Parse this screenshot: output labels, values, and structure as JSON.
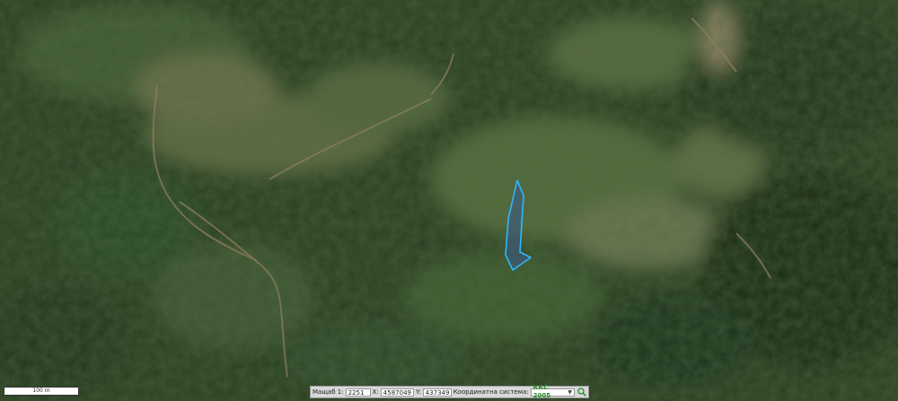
{
  "map": {
    "colors": {
      "forest_dark": "#1f3319",
      "forest": "#2c4524",
      "meadow": "#5a6a3e",
      "meadow_light": "#7b7a55",
      "track": "#8a7c5c",
      "parcel_stroke": "#2fb7ff",
      "parcel_fill": "#3b5a8a"
    }
  },
  "scalebar": {
    "label": "100 m"
  },
  "toolbar": {
    "scale_label": "Мащаб 1:",
    "scale_value": "2251",
    "x_label": "X:",
    "x_value": "4587049",
    "y_label": "Y:",
    "y_value": "437349",
    "system_label": "Координатна система:",
    "system_value": "ККС 2005",
    "system_icon": "chevron-down-icon",
    "search_icon": "search-icon"
  }
}
